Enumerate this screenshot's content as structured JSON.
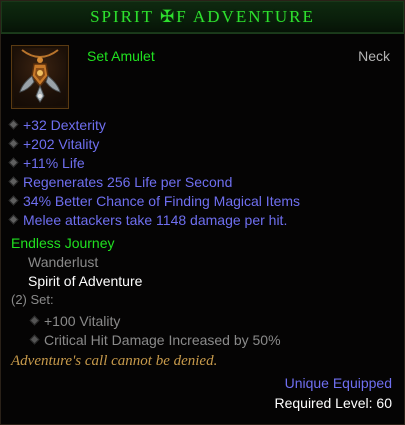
{
  "header": {
    "title": "SPIRIT ✠F ADVENTURE"
  },
  "item": {
    "type": "Set Amulet",
    "slot": "Neck",
    "icon": "amulet-icon"
  },
  "affixes": [
    "+32 Dexterity",
    "+202 Vitality",
    "+11% Life",
    "Regenerates 256 Life per Second",
    "34% Better Chance of Finding Magical Items",
    "Melee attackers take 1148 damage per hit."
  ],
  "set": {
    "name": "Endless Journey",
    "pieces": [
      {
        "name": "Wanderlust"
      },
      {
        "name": "Spirit of Adventure"
      }
    ],
    "bonus_header": "(2) Set:",
    "bonuses": [
      "+100 Vitality",
      "Critical Hit Damage Increased by 50%"
    ]
  },
  "flavor": "Adventure's call cannot be denied.",
  "footer": {
    "unique": "Unique Equipped",
    "requirement": "Required Level: 60"
  },
  "colors": {
    "title_green": "#2ee02e",
    "magic_blue": "#6f6ff0",
    "set_green": "#20e020",
    "flavor_gold": "#c79a4b",
    "inactive_gray": "#8a8a8a"
  }
}
